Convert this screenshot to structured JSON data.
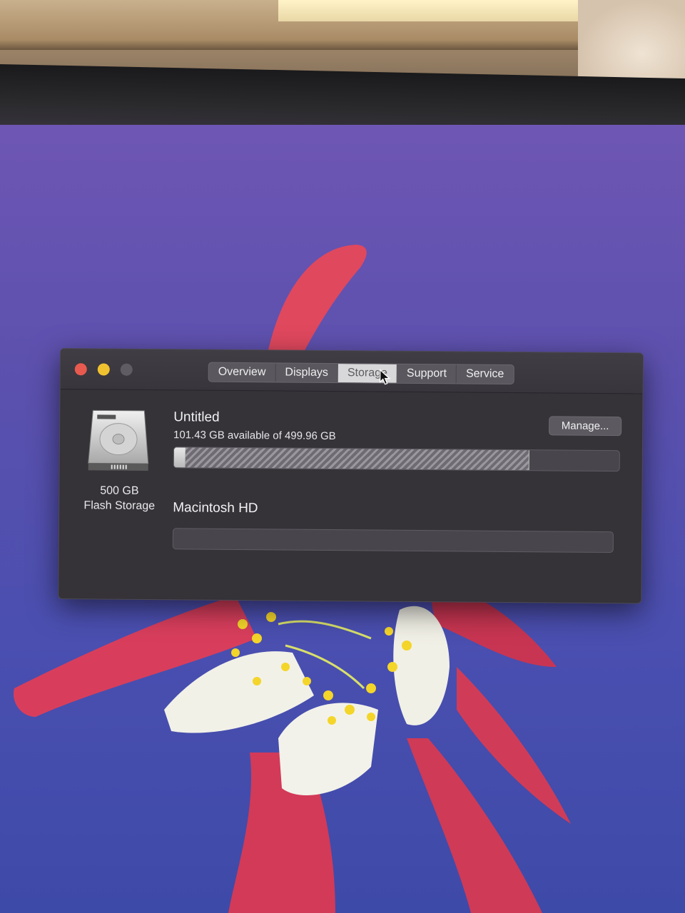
{
  "window": {
    "tabs": [
      {
        "label": "Overview"
      },
      {
        "label": "Displays"
      },
      {
        "label": "Storage",
        "active": true
      },
      {
        "label": "Support"
      },
      {
        "label": "Service"
      }
    ],
    "manage_label": "Manage...",
    "colors": {
      "close": "#e85a4f",
      "minimize": "#f0c230",
      "zoom": "#5f5d63"
    }
  },
  "drive": {
    "size": "500 GB",
    "type": "Flash Storage",
    "icon": "hard-drive-icon"
  },
  "volumes": [
    {
      "name": "Untitled",
      "available": "101.43 GB available of 499.96 GB",
      "used_fraction": 0.797,
      "system_fraction": 0.026
    },
    {
      "name": "Macintosh HD"
    }
  ]
}
